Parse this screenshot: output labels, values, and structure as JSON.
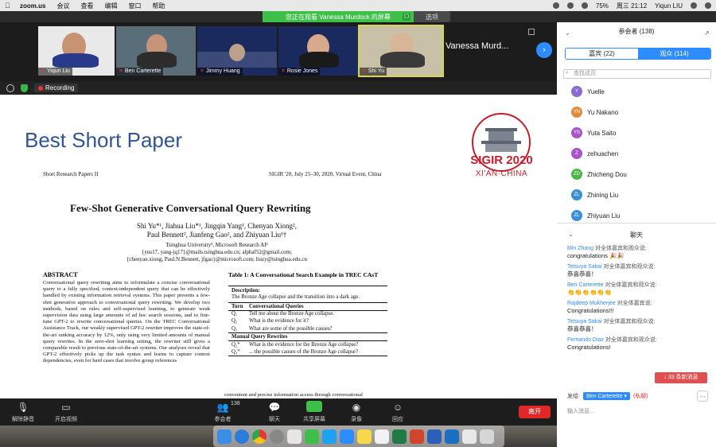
{
  "menubar": {
    "app": "zoom.us",
    "items": [
      "会议",
      "查看",
      "编辑",
      "窗口",
      "帮助"
    ],
    "battery": "75%",
    "datetime": "周三 21:12",
    "user": "Yiqun LIU"
  },
  "banner": {
    "text": "您正在观看 Vanessa Murdock 的屏幕",
    "view_option": "选项"
  },
  "video_tiles": [
    {
      "name": "Yiqun Liu"
    },
    {
      "name": "Ben Carterette"
    },
    {
      "name": "Jimmy Huang"
    },
    {
      "name": "Rosie Jones"
    },
    {
      "name": "Shi Yu"
    }
  ],
  "active_speaker": "Vanessa Murd...",
  "recording": {
    "label": "Recording"
  },
  "slide": {
    "heading": "Best Short Paper",
    "logo_text": "SIGIR 2020",
    "logo_sub": "XI'AN·CHINA",
    "header_left": "Short Research Papers II",
    "header_right": "SIGIR '20, July 25–30, 2020, Virtual Event, China",
    "title": "Few-Shot Generative Conversational Query Rewriting",
    "authors_line1": "Shi Yu*¹, Jiahua Liu*¹, Jingqin Yang¹, Chenyan Xiong²,",
    "authors_line2": "Paul Bennett², Jianfeng Gao², and Zhiyuan Liu¹†",
    "affil_line1": "Tsinghua University¹, Microsoft Research AI²",
    "affil_line2": "{yus17, yang-jq17}@mails.tsinghua.edu.cn; alphaf52@gmail.com;",
    "affil_line3": "{chenyan.xiong, Paul.N.Bennett, jfgao}@microsoft.com; liuzy@tsinghua.edu.cn",
    "abstract_heading": "ABSTRACT",
    "abstract": "Conversational query rewriting aims to reformulate a concise conversational query to a fully specified, context-independent query that can be effectively handled by existing information retrieval systems. This paper presents a few-shot generative approach to conversational query rewriting. We develop two methods, based on rules and self-supervised learning, to generate weak supervision data using large amounts of ad hoc search sessions, and to fine-tune GPT-2 to rewrite conversational queries. On the TREC Conversational Assistance Track, our weakly supervised GPT-2 rewriter improves the state-of-the-art ranking accuracy by 12%, only using very limited amounts of manual query rewrites. In the zero-shot learning setting, the rewriter still gives a comparable result to previous state-of-the-art systems. Our analyses reveal that GPT-2 effectively picks up the task syntax and learns to capture context dependencies, even for hard cases that involve group references",
    "table_caption": "Table 1: A Conversational Search Example in TREC CAsT",
    "table_desc_label": "Description:",
    "table_desc": "The Bronze Age collapse and the transition into a dark age.",
    "table_col_turn": "Turn",
    "table_col_queries": "Conversational Queries",
    "table_rows": [
      {
        "turn": "Q₁",
        "text": "Tell me about the Bronze Age collapse."
      },
      {
        "turn": "Q₂",
        "text": "What is the evidence for it?"
      },
      {
        "turn": "Q₃",
        "text": "What are some of the possible causes?"
      }
    ],
    "table_manual_label": "Manual Query Rewrites",
    "table_manual_rows": [
      {
        "turn": "Q₂*",
        "text": "What is the evidence for the Bronze Age collapse?"
      },
      {
        "turn": "Q₃*",
        "text": "... the possible causes of the Bronze Age collapse?"
      }
    ],
    "bottom_text": "convenient and precise information access through conversational"
  },
  "toolbar": {
    "mute": "解除静音",
    "video": "开启视频",
    "participants": "参会者",
    "participant_count": "138",
    "chat": "聊天",
    "share": "共享屏幕",
    "record": "录像",
    "reactions": "回应",
    "leave": "离开"
  },
  "panel": {
    "title": "参会者 (138)",
    "tab_panelists": "嘉宾 (22)",
    "tab_attendees": "观众 (114)",
    "search_placeholder": "查找成员",
    "participants": [
      {
        "initials": "Y",
        "name": "Yuelle",
        "color": "#8a6bd1"
      },
      {
        "initials": "YN",
        "name": "Yu Nakano",
        "color": "#e08a3c"
      },
      {
        "initials": "YS",
        "name": "Yuta Saito",
        "color": "#a855c9"
      },
      {
        "initials": "Z",
        "name": "zehuachen",
        "color": "#a855c9"
      },
      {
        "initials": "ZD",
        "name": "Zhicheng Dou",
        "color": "#4cb84a"
      },
      {
        "initials": "ZL",
        "name": "Zhining Liu",
        "color": "#3b8fd8"
      },
      {
        "initials": "ZL",
        "name": "Zhiyuan Liu",
        "color": "#3b8fd8"
      }
    ],
    "chat_title": "聊天",
    "messages": [
      {
        "from": "Min Zhang",
        "to": "对全体嘉宾和观众说:",
        "text": "congratulations 🎉🎉"
      },
      {
        "from": "Tetsuya Sakai",
        "to": "对全体嘉宾和观众说:",
        "text": "恭喜恭喜！"
      },
      {
        "from": "Ben Carterette",
        "to": "对全体嘉宾和观众说:",
        "text": "👏👏👏👏👏👏"
      },
      {
        "from": "Rajdeep Mukherjee",
        "to": "对全体嘉宾说:",
        "text": "Congratulations!!!"
      },
      {
        "from": "Tetsuya Sakai",
        "to": "对全体嘉宾和观众说:",
        "text": "恭喜恭喜！"
      },
      {
        "from": "Fernando Diaz",
        "to": "对全体嘉宾和观众说:",
        "text": "Congratulations!"
      }
    ],
    "new_messages": "↓ 33 条新消息",
    "send_to_label": "发给:",
    "send_to_value": "Ben Carterette ▾",
    "private_label": "(私聊)",
    "input_placeholder": "输入消息..."
  }
}
